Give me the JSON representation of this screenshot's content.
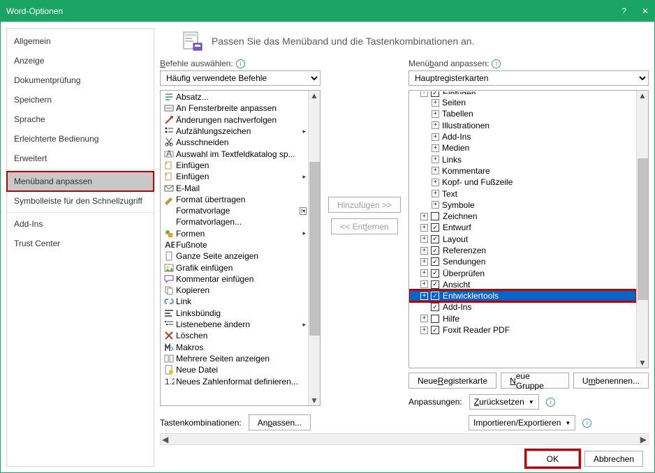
{
  "title": "Word-Optionen",
  "sidebar": {
    "items": [
      "Allgemein",
      "Anzeige",
      "Dokumentprüfung",
      "Speichern",
      "Sprache",
      "Erleichterte Bedienung",
      "Erweitert",
      "Menüband anpassen",
      "Symbolleiste für den Schnellzugriff",
      "Add-Ins",
      "Trust Center"
    ],
    "selected_index": 7
  },
  "header": "Passen Sie das Menüband und die Tastenkombinationen an.",
  "left": {
    "label": "Befehle auswählen:",
    "combo": "Häufig verwendete Befehle",
    "commands": [
      {
        "icon": "para",
        "label": "Absatz...",
        "sub": false
      },
      {
        "icon": "fitw",
        "label": "An Fensterbreite anpassen",
        "sub": false
      },
      {
        "icon": "track",
        "label": "Änderungen nachverfolgen",
        "sub": false
      },
      {
        "icon": "bullets",
        "label": "Aufzählungszeichen",
        "sub": true
      },
      {
        "icon": "cut",
        "label": "Ausschneiden",
        "sub": false
      },
      {
        "icon": "textbox",
        "label": "Auswahl im Textfeldkatalog sp...",
        "sub": false
      },
      {
        "icon": "insert",
        "label": "Einfügen",
        "sub": false
      },
      {
        "icon": "insert",
        "label": "Einfügen",
        "sub": true
      },
      {
        "icon": "mail",
        "label": "E-Mail",
        "sub": false
      },
      {
        "icon": "brush",
        "label": "Format übertragen",
        "sub": false
      },
      {
        "icon": "blank",
        "label": "Formatvorlage",
        "sub": false,
        "tail": "dd"
      },
      {
        "icon": "blank",
        "label": "Formatvorlagen...",
        "sub": false
      },
      {
        "icon": "shapes",
        "label": "Formen",
        "sub": true
      },
      {
        "icon": "fn",
        "label": "Fußnote",
        "sub": false
      },
      {
        "icon": "page",
        "label": "Ganze Seite anzeigen",
        "sub": false
      },
      {
        "icon": "pic",
        "label": "Grafik einfügen",
        "sub": false
      },
      {
        "icon": "comment",
        "label": "Kommentar einfügen",
        "sub": false
      },
      {
        "icon": "copy",
        "label": "Kopieren",
        "sub": false
      },
      {
        "icon": "link",
        "label": "Link",
        "sub": false
      },
      {
        "icon": "alignl",
        "label": "Linksbündig",
        "sub": false
      },
      {
        "icon": "listlvl",
        "label": "Listenebene ändern",
        "sub": true
      },
      {
        "icon": "delete",
        "label": "Löschen",
        "sub": false
      },
      {
        "icon": "macro",
        "label": "Makros",
        "sub": false
      },
      {
        "icon": "pages",
        "label": "Mehrere Seiten anzeigen",
        "sub": false
      },
      {
        "icon": "new",
        "label": "Neue Datei",
        "sub": false
      },
      {
        "icon": "num",
        "label": "Neues Zahlenformat definieren...",
        "sub": false
      }
    ]
  },
  "mid": {
    "add": "Hinzufügen >>",
    "remove": "<< Entfernen"
  },
  "right": {
    "label": "Menüband anpassen:",
    "combo": "Hauptregisterkarten",
    "tree": [
      {
        "lv": 1,
        "exp": "-",
        "txt": "Einfügen",
        "top": true
      },
      {
        "lv": 2,
        "exp": "+",
        "txt": "Seiten"
      },
      {
        "lv": 2,
        "exp": "+",
        "txt": "Tabellen"
      },
      {
        "lv": 2,
        "exp": "+",
        "txt": "Illustrationen"
      },
      {
        "lv": 2,
        "exp": "+",
        "txt": "Add-Ins"
      },
      {
        "lv": 2,
        "exp": "+",
        "txt": "Medien"
      },
      {
        "lv": 2,
        "exp": "+",
        "txt": "Links"
      },
      {
        "lv": 2,
        "exp": "+",
        "txt": "Kommentare"
      },
      {
        "lv": 2,
        "exp": "+",
        "txt": "Kopf- und Fußzeile"
      },
      {
        "lv": 2,
        "exp": "+",
        "txt": "Text"
      },
      {
        "lv": 2,
        "exp": "+",
        "txt": "Symbole"
      },
      {
        "lv": 1,
        "exp": "+",
        "cb": false,
        "txt": "Zeichnen"
      },
      {
        "lv": 1,
        "exp": "+",
        "cb": true,
        "txt": "Entwurf"
      },
      {
        "lv": 1,
        "exp": "+",
        "cb": true,
        "txt": "Layout"
      },
      {
        "lv": 1,
        "exp": "+",
        "cb": true,
        "txt": "Referenzen"
      },
      {
        "lv": 1,
        "exp": "+",
        "cb": true,
        "txt": "Sendungen"
      },
      {
        "lv": 1,
        "exp": "+",
        "cb": true,
        "txt": "Überprüfen"
      },
      {
        "lv": 1,
        "exp": "+",
        "cb": true,
        "txt": "Ansicht"
      },
      {
        "lv": 1,
        "exp": "+",
        "cb": true,
        "txt": "Entwicklertools",
        "sel": true
      },
      {
        "lv": 1,
        "exp": "",
        "cb": true,
        "txt": "Add-Ins"
      },
      {
        "lv": 1,
        "exp": "+",
        "cb": false,
        "txt": "Hilfe"
      },
      {
        "lv": 1,
        "exp": "+",
        "cb": true,
        "txt": "Foxit Reader PDF"
      }
    ],
    "buttons": {
      "new_tab": "Neue Registerkarte",
      "new_group": "Neue Gruppe",
      "rename": "Umbenennen..."
    },
    "customize_lbl": "Anpassungen:",
    "reset": "Zurücksetzen",
    "impexp": "Importieren/Exportieren"
  },
  "keycombo": {
    "label": "Tastenkombinationen:",
    "btn": "Anpassen..."
  },
  "footer": {
    "ok": "OK",
    "cancel": "Abbrechen"
  }
}
